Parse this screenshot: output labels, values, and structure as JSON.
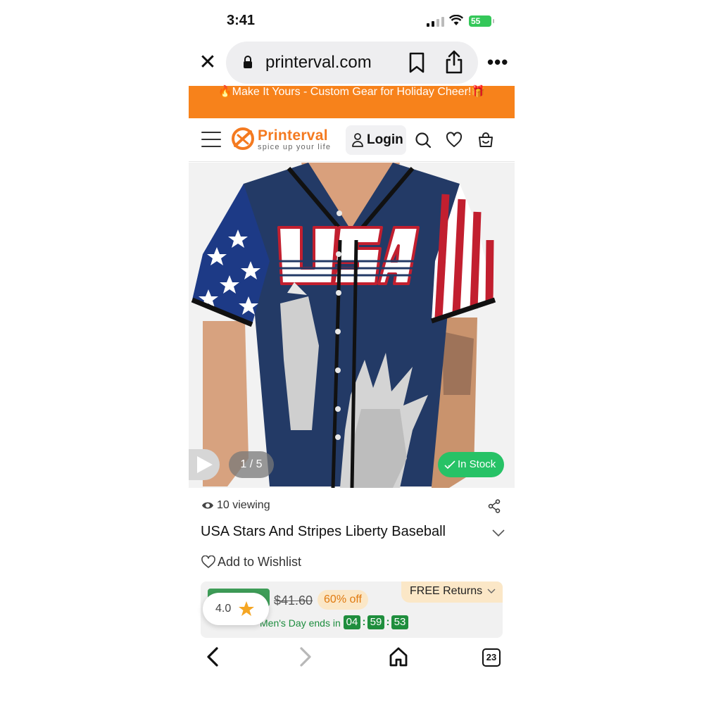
{
  "status_bar": {
    "time": "3:41",
    "battery": "55"
  },
  "browser": {
    "url": "printerval.com"
  },
  "promo": {
    "text": "🔥Make It Yours - Custom Gear for Holiday Cheer!🎁"
  },
  "header": {
    "brand": "Printerval",
    "tagline": "spice up your life",
    "login_label": "Login"
  },
  "gallery": {
    "counter": "1 / 5",
    "stock_label": "In Stock",
    "jersey_text": "USA"
  },
  "product": {
    "viewing": "10 viewing",
    "title": "USA Stars And Stripes Liberty Baseball",
    "wishlist_label": "Add to Wishlist",
    "original_price": "$41.60",
    "discount": "60% off",
    "free_returns": "FREE Returns",
    "deal_label": "Men's Day ends in",
    "timer": [
      "04",
      "59",
      "53"
    ],
    "rating": "4.0"
  },
  "tabs_count": "23",
  "colors": {
    "promo_bg": "#f7821b",
    "brand_orange": "#f47a20",
    "stock_green": "#27c266",
    "timer_green": "#1f8e3d",
    "jersey_navy": "#233a66"
  }
}
